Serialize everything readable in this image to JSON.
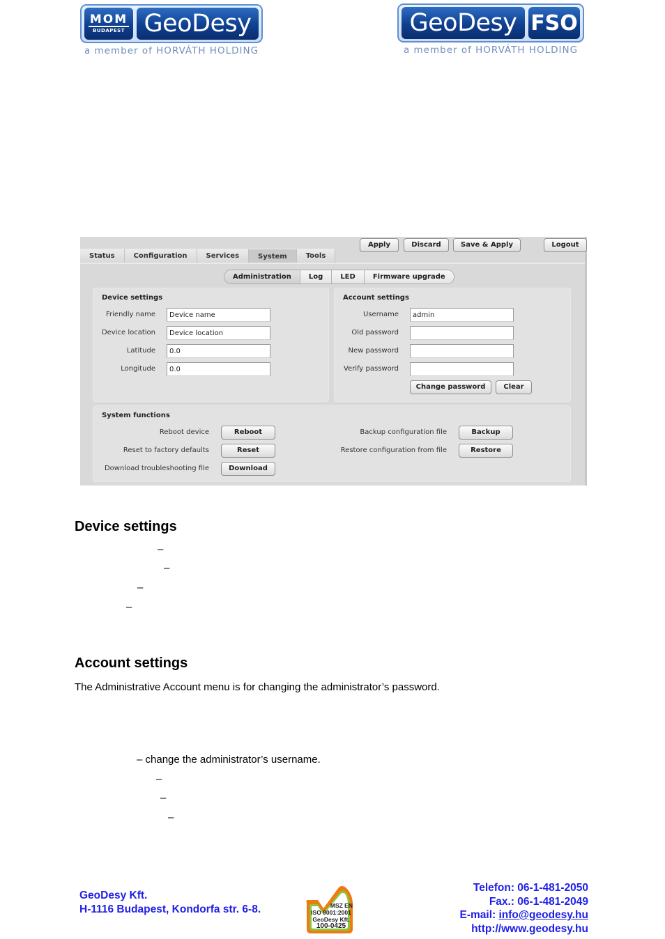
{
  "header": {
    "left_logo": {
      "mark_top": "MOM",
      "mark_bottom": "BUDAPEST",
      "brand": "GeoDesy",
      "tagline": "a member of HORVÁTH HOLDING"
    },
    "right_logo": {
      "brand": "GeoDesy",
      "suffix": "FSO",
      "tagline": "a member of HORVÁTH HOLDING"
    }
  },
  "ui": {
    "tabs": [
      {
        "label": "Status",
        "active": false
      },
      {
        "label": "Configuration",
        "active": false
      },
      {
        "label": "Services",
        "active": false
      },
      {
        "label": "System",
        "active": true
      },
      {
        "label": "Tools",
        "active": false
      }
    ],
    "actions": {
      "apply": "Apply",
      "discard": "Discard",
      "save_apply": "Save & Apply",
      "logout": "Logout"
    },
    "subtabs": [
      {
        "label": "Administration",
        "active": true
      },
      {
        "label": "Log",
        "active": false
      },
      {
        "label": "LED",
        "active": false
      },
      {
        "label": "Firmware upgrade",
        "active": false
      }
    ],
    "device_settings": {
      "title": "Device settings",
      "friendly_name": {
        "label": "Friendly name",
        "value": "Device name"
      },
      "device_location": {
        "label": "Device location",
        "value": "Device location"
      },
      "latitude": {
        "label": "Latitude",
        "value": "0.0"
      },
      "longitude": {
        "label": "Longitude",
        "value": "0.0"
      }
    },
    "account_settings": {
      "title": "Account settings",
      "username": {
        "label": "Username",
        "value": "admin"
      },
      "old_password": {
        "label": "Old password",
        "value": ""
      },
      "new_password": {
        "label": "New password",
        "value": ""
      },
      "verify_password": {
        "label": "Verify password",
        "value": ""
      },
      "change_password_label": "Change password",
      "clear_label": "Clear"
    },
    "system_functions": {
      "title": "System functions",
      "reboot": {
        "label": "Reboot device",
        "button": "Reboot"
      },
      "reset": {
        "label": "Reset to factory defaults",
        "button": "Reset"
      },
      "download": {
        "label": "Download troubleshooting file",
        "button": "Download"
      },
      "backup": {
        "label": "Backup configuration file",
        "button": "Backup"
      },
      "restore": {
        "label": "Restore configuration from file",
        "button": "Restore"
      }
    }
  },
  "document": {
    "device_heading": "Device settings",
    "device_dashes": [
      "–",
      "–",
      "–",
      "–"
    ],
    "account_heading": "Account settings",
    "account_intro": "The Administrative Account menu is for changing the administrator’s password.",
    "username_desc": "– change the administrator’s username.",
    "account_dashes": [
      "–",
      "–",
      "–"
    ]
  },
  "footer": {
    "company": "GeoDesy Kft.",
    "address": "H-1116 Budapest, Kondorfa str. 6-8.",
    "iso": {
      "line1": "MSZ EN",
      "line2": "ISO 9001:2001",
      "line3": "GeoDesy Kft.",
      "line4": "100-0425"
    },
    "phone": "Telefon: 06-1-481-2050",
    "fax": "Fax.: 06-1-481-2049",
    "email_label": "E-mail: ",
    "email": "info@geodesy.hu",
    "website": "http://www.geodesy.hu"
  },
  "colors": {
    "footer_blue": "#1f1fe8",
    "logo_blue": "#0f3f8f",
    "iso_orange": "#f07a12",
    "iso_green": "#8cc63f"
  }
}
